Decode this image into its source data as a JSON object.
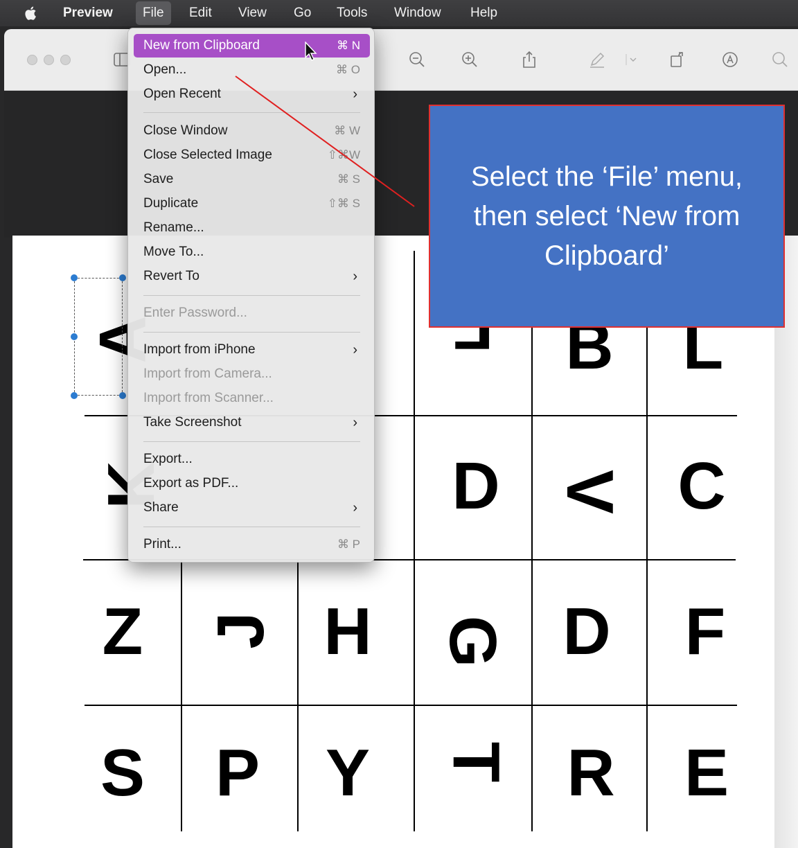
{
  "menubar": {
    "apple": "apple-logo",
    "app_name": "Preview",
    "items": [
      "File",
      "Edit",
      "View",
      "Go",
      "Tools",
      "Window",
      "Help"
    ]
  },
  "file_menu": {
    "items": [
      {
        "label": "New from Clipboard",
        "shortcut": "⌘ N",
        "highlighted": true
      },
      {
        "label": "Open...",
        "shortcut": "⌘ O"
      },
      {
        "label": "Open Recent",
        "submenu": true
      },
      {
        "label": "Close Window",
        "shortcut": "⌘ W"
      },
      {
        "label": "Close Selected Image",
        "shortcut": "⇧⌘W"
      },
      {
        "label": "Save",
        "shortcut": "⌘ S"
      },
      {
        "label": "Duplicate",
        "shortcut": "⇧⌘ S"
      },
      {
        "label": "Rename..."
      },
      {
        "label": "Move To..."
      },
      {
        "label": "Revert To",
        "submenu": true
      },
      {
        "label": "Enter Password...",
        "disabled": true
      },
      {
        "label": "Import from iPhone",
        "submenu": true
      },
      {
        "label": "Import from Camera...",
        "disabled": true
      },
      {
        "label": "Import from Scanner...",
        "disabled": true
      },
      {
        "label": "Take Screenshot",
        "submenu": true
      },
      {
        "label": "Export..."
      },
      {
        "label": "Export as PDF..."
      },
      {
        "label": "Share",
        "submenu": true
      },
      {
        "label": "Print...",
        "shortcut": "⌘ P"
      }
    ],
    "submenu_glyph": "›"
  },
  "callout": {
    "text": "Select the ‘File’ menu, then select ‘New from Clipboard’"
  },
  "document": {
    "letters": {
      "r1": [
        "A",
        "",
        "",
        "F",
        "B",
        "L"
      ],
      "r2": [
        "K",
        "",
        "",
        "D",
        "V",
        "C"
      ],
      "r3": [
        "Z",
        "J",
        "H",
        "G",
        "D",
        "F"
      ],
      "r4": [
        "S",
        "P",
        "Y",
        "T",
        "R",
        "E"
      ]
    }
  },
  "colors": {
    "menu_highlight": "#a74fc7",
    "callout_fill": "#4472c4",
    "callout_border": "#e03030",
    "selection_handle": "#2c7cd1"
  }
}
